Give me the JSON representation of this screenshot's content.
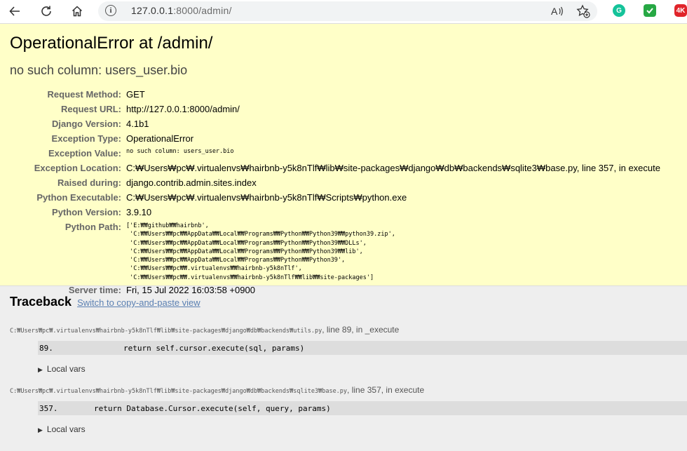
{
  "browser": {
    "url_host": "127.0.0.1",
    "url_rest": ":8000/admin/",
    "icons": [
      "back-arrow-icon",
      "reload-icon",
      "home-icon",
      "info-icon",
      "read-aloud-icon",
      "favorites-add-icon",
      "grammarly-icon",
      "shield-extension-icon",
      "video-4k-extension-icon"
    ],
    "ext_4k_label": "4K"
  },
  "summary": {
    "title": "OperationalError at /admin/",
    "subtitle": "no such column: users_user.bio",
    "rows": [
      {
        "label": "Request Method:",
        "value": "GET"
      },
      {
        "label": "Request URL:",
        "value": "http://127.0.0.1:8000/admin/"
      },
      {
        "label": "Django Version:",
        "value": "4.1b1"
      },
      {
        "label": "Exception Type:",
        "value": "OperationalError"
      },
      {
        "label": "Exception Value:",
        "value": "no such column: users_user.bio"
      },
      {
        "label": "Exception Location:",
        "value": "C:₩Users₩pc₩.virtualenvs₩hairbnb-y5k8nTlf₩lib₩site-packages₩django₩db₩backends₩sqlite3₩base.py, line 357, in execute"
      },
      {
        "label": "Raised during:",
        "value": "django.contrib.admin.sites.index"
      },
      {
        "label": "Python Executable:",
        "value": "C:₩Users₩pc₩.virtualenvs₩hairbnb-y5k8nTlf₩Scripts₩python.exe"
      },
      {
        "label": "Python Version:",
        "value": "3.9.10"
      },
      {
        "label": "Python Path:",
        "value": "['E:₩₩github₩₩hairbnb',\n 'C:₩₩Users₩₩pc₩₩AppData₩₩Local₩₩Programs₩₩Python₩₩Python39₩₩python39.zip',\n 'C:₩₩Users₩₩pc₩₩AppData₩₩Local₩₩Programs₩₩Python₩₩Python39₩₩DLLs',\n 'C:₩₩Users₩₩pc₩₩AppData₩₩Local₩₩Programs₩₩Python₩₩Python39₩₩lib',\n 'C:₩₩Users₩₩pc₩₩AppData₩₩Local₩₩Programs₩₩Python₩₩Python39',\n 'C:₩₩Users₩₩pc₩₩.virtualenvs₩₩hairbnb-y5k8nTlf',\n 'C:₩₩Users₩₩pc₩₩.virtualenvs₩₩hairbnb-y5k8nTlf₩₩lib₩₩site-packages']"
      },
      {
        "label": "Server time:",
        "value": "Fri, 15 Jul 2022 16:03:58 +0900"
      }
    ]
  },
  "traceback": {
    "title": "Traceback",
    "switch_link": "Switch to copy-and-paste view",
    "frames": [
      {
        "file": "C:₩Users₩pc₩.virtualenvs₩hairbnb-y5k8nTlf₩lib₩site-packages₩django₩db₩backends₩utils.py",
        "suffix": ", line 89, in _execute",
        "line_no": "89.",
        "code": "return self.cursor.execute(sql, params)",
        "local_vars": "Local vars"
      },
      {
        "file": "C:₩Users₩pc₩.virtualenvs₩hairbnb-y5k8nTlf₩lib₩site-packages₩django₩db₩backends₩sqlite3₩base.py",
        "suffix": ", line 357, in execute",
        "line_no": "357.",
        "code": "return Database.Cursor.execute(self, query, params)",
        "local_vars": "Local vars"
      }
    ]
  }
}
